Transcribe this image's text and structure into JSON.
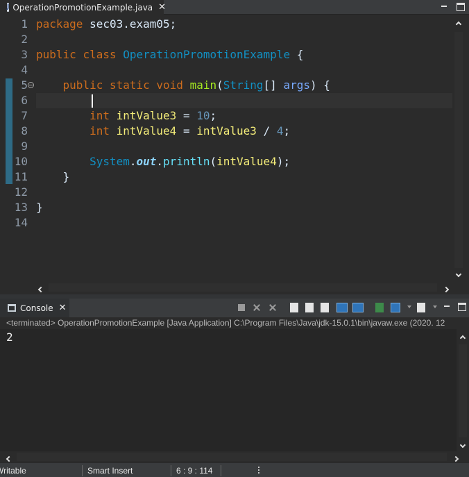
{
  "editor": {
    "tab": {
      "icon": "java-file-icon",
      "icon_glyph": "J",
      "title": "OperationPromotionExample.java",
      "close_glyph": "✕"
    },
    "line_numbers": [
      "1",
      "2",
      "3",
      "4",
      "5",
      "6",
      "7",
      "8",
      "9",
      "10",
      "11",
      "12",
      "13",
      "14"
    ],
    "current_line": 6,
    "lines": [
      [
        {
          "t": "package",
          "c": "kw"
        },
        {
          "t": " sec03.exam05;",
          "c": "plain"
        }
      ],
      [],
      [
        {
          "t": "public",
          "c": "kw"
        },
        {
          "t": " ",
          "c": "plain"
        },
        {
          "t": "class",
          "c": "kw"
        },
        {
          "t": " ",
          "c": "plain"
        },
        {
          "t": "OperationPromotionExample",
          "c": "cls"
        },
        {
          "t": " {",
          "c": "plain"
        }
      ],
      [],
      [
        {
          "t": "    ",
          "c": "plain"
        },
        {
          "t": "public",
          "c": "kw"
        },
        {
          "t": " ",
          "c": "plain"
        },
        {
          "t": "static",
          "c": "kw"
        },
        {
          "t": " ",
          "c": "plain"
        },
        {
          "t": "void",
          "c": "kw"
        },
        {
          "t": " ",
          "c": "plain"
        },
        {
          "t": "main",
          "c": "fn"
        },
        {
          "t": "(",
          "c": "plain"
        },
        {
          "t": "String",
          "c": "cls"
        },
        {
          "t": "[] ",
          "c": "plain"
        },
        {
          "t": "args",
          "c": "var"
        },
        {
          "t": ") {",
          "c": "plain"
        }
      ],
      [],
      [
        {
          "t": "        ",
          "c": "plain"
        },
        {
          "t": "int",
          "c": "kw"
        },
        {
          "t": " ",
          "c": "plain"
        },
        {
          "t": "intValue3",
          "c": "loc"
        },
        {
          "t": " = ",
          "c": "plain"
        },
        {
          "t": "10",
          "c": "num"
        },
        {
          "t": ";",
          "c": "plain"
        }
      ],
      [
        {
          "t": "        ",
          "c": "plain"
        },
        {
          "t": "int",
          "c": "kw"
        },
        {
          "t": " ",
          "c": "plain"
        },
        {
          "t": "intValue4",
          "c": "loc"
        },
        {
          "t": " = ",
          "c": "plain"
        },
        {
          "t": "intValue3",
          "c": "loc"
        },
        {
          "t": " / ",
          "c": "plain"
        },
        {
          "t": "4",
          "c": "num"
        },
        {
          "t": ";",
          "c": "plain"
        }
      ],
      [],
      [
        {
          "t": "        ",
          "c": "plain"
        },
        {
          "t": "System",
          "c": "cls"
        },
        {
          "t": ".",
          "c": "plain"
        },
        {
          "t": "out",
          "c": "stat"
        },
        {
          "t": ".",
          "c": "plain"
        },
        {
          "t": "println",
          "c": "fld"
        },
        {
          "t": "(",
          "c": "plain"
        },
        {
          "t": "intValue4",
          "c": "loc"
        },
        {
          "t": ");",
          "c": "plain"
        }
      ],
      [
        {
          "t": "    }",
          "c": "plain"
        }
      ],
      [],
      [
        {
          "t": "}",
          "c": "plain"
        }
      ],
      []
    ]
  },
  "console": {
    "tab_icon": "console-icon",
    "tab_label": "Console",
    "close_glyph": "✕",
    "status": "<terminated> OperationPromotionExample [Java Application] C:\\Program Files\\Java\\jdk-15.0.1\\bin\\javaw.exe  (2020. 12",
    "output": "2",
    "toolbar_icons": [
      "terminate-icon",
      "remove-launch-icon",
      "remove-all-terminated-icon",
      "scroll-lock-icon",
      "word-wrap-icon",
      "show-on-stdout-icon",
      "show-on-stderr-icon",
      "pin-console-icon",
      "display-selected-console-icon",
      "open-console-icon",
      "view-menu-icon",
      "minimize-icon",
      "maximize-icon"
    ]
  },
  "statusbar": {
    "writable": "Writable",
    "insert_mode": "Smart Insert",
    "position": "6 : 9 : 114"
  }
}
